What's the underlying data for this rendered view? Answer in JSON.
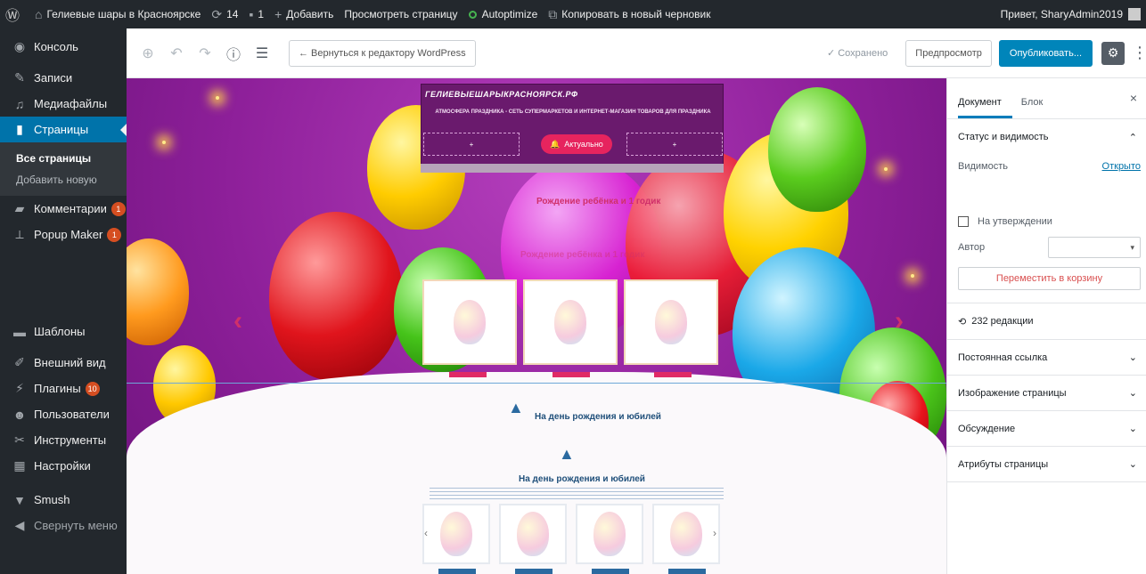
{
  "adminbar": {
    "site_name": "Гелиевые шары в Красноярске",
    "updates_count": "14",
    "comments_count": "1",
    "add_new": "Добавить",
    "view_page": "Просмотреть страницу",
    "autoptimize": "Autoptimize",
    "copy_draft": "Копировать в новый черновик",
    "greeting": "Привет, SharyAdmin2019"
  },
  "sidebar": {
    "items": [
      {
        "label": "Консоль",
        "icon": "dashboard-icon"
      },
      {
        "label": "Записи",
        "icon": "pin-icon"
      },
      {
        "label": "Медиафайлы",
        "icon": "media-icon"
      },
      {
        "label": "Страницы",
        "icon": "pages-icon"
      },
      {
        "label": "Комментарии",
        "icon": "comments-icon",
        "badge": "1"
      },
      {
        "label": "Popup Maker",
        "icon": "popup-icon",
        "badge": "1"
      },
      {
        "label": "Шаблоны",
        "icon": "templates-icon"
      },
      {
        "label": "Внешний вид",
        "icon": "appearance-icon"
      },
      {
        "label": "Плагины",
        "icon": "plugins-icon",
        "badge": "10"
      },
      {
        "label": "Пользователи",
        "icon": "users-icon"
      },
      {
        "label": "Инструменты",
        "icon": "tools-icon"
      },
      {
        "label": "Настройки",
        "icon": "settings-icon"
      },
      {
        "label": "Smush",
        "icon": "smush-icon"
      },
      {
        "label": "Свернуть меню",
        "icon": "collapse-icon"
      }
    ],
    "submenu": {
      "all_pages": "Все страницы",
      "add_new": "Добавить новую"
    }
  },
  "toolbar": {
    "back_label": "← Вернуться к редактору WordPress",
    "saved_label": "✓ Сохранено",
    "preview_label": "Предпросмотр",
    "publish_label": "Опубликовать..."
  },
  "canvas": {
    "site_title": "ГЕЛИЕВЫЕШАРЫКРАСНОЯРСК.РФ",
    "site_subtitle": "АТМОСФЕРА ПРАЗДНИКА - СЕТЬ СУПЕРМАРКЕТОВ И ИНТЕРНЕТ-МАГАЗИН ТОВАРОВ ДЛЯ ПРАЗДНИКА",
    "plus": "+",
    "aktual": "Актуально",
    "section1_title": "Рождение ребёнка и 1 годик",
    "section1_title_faint": "Рождение ребёнка и 1 годик",
    "section2_title": "На день рождения и юбилей",
    "section2_title_b": "На день рождения и юбилей",
    "arrow_left": "‹",
    "arrow_right": "›"
  },
  "settings": {
    "tab_document": "Документ",
    "tab_block": "Блок",
    "close": "×",
    "status_title": "Статус и видимость",
    "visibility_label": "Видимость",
    "visibility_value": "Открыто",
    "pending_label": "На утверждении",
    "author_label": "Автор",
    "trash_label": "Переместить в корзину",
    "revisions_label": "232 редакции",
    "permalink": "Постоянная ссылка",
    "featured_image": "Изображение страницы",
    "discussion": "Обсуждение",
    "page_attributes": "Атрибуты страницы"
  },
  "colors": {
    "admin_bg": "#23282d",
    "accent": "#0073aa",
    "publish": "#0085ba",
    "badge": "#d54e21",
    "trash": "#d94f4f"
  }
}
